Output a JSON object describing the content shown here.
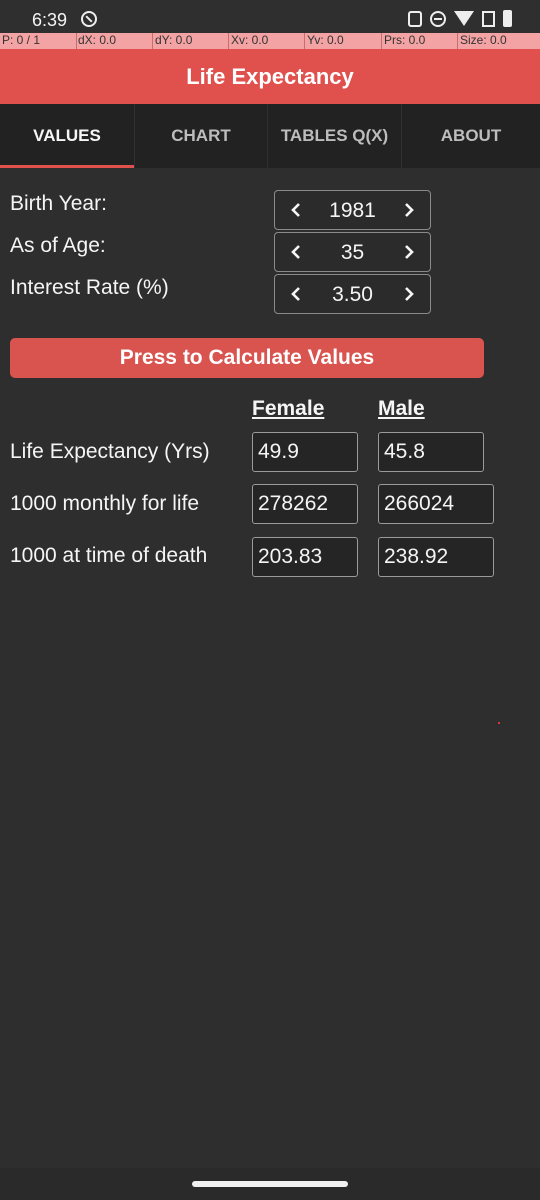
{
  "status_bar": {
    "time": "6:39"
  },
  "pointer_location": {
    "cells": [
      "P: 0 / 1",
      "dX: 0.0",
      "dY: 0.0",
      "Xv: 0.0",
      "Yv: 0.0",
      "Prs: 0.0",
      "Size: 0.0"
    ]
  },
  "app": {
    "title": "Life Expectancy"
  },
  "tabs": [
    {
      "label": "VALUES",
      "active": true
    },
    {
      "label": "CHART",
      "active": false
    },
    {
      "label": "TABLES Q(X)",
      "active": false
    },
    {
      "label": "ABOUT",
      "active": false
    }
  ],
  "inputs": {
    "birth_year": {
      "label": "Birth Year:",
      "value": "1981"
    },
    "as_of_age": {
      "label": "As of Age:",
      "value": "35"
    },
    "interest_rate": {
      "label": "Interest Rate (%)",
      "value": "3.50"
    }
  },
  "calculate_button": {
    "label": "Press to Calculate Values"
  },
  "results": {
    "columns": [
      "Female",
      "Male"
    ],
    "rows": [
      {
        "label": "Life Expectancy (Yrs)",
        "female": "49.9",
        "male": "45.8"
      },
      {
        "label": "1000 monthly for life",
        "female": "278262",
        "male": "266024"
      },
      {
        "label": "1000 at time of death",
        "female": "203.83",
        "male": "238.92"
      }
    ]
  },
  "colors": {
    "accent": "#e0514e",
    "background": "#2e2e2e",
    "tab_bar": "#222222"
  }
}
